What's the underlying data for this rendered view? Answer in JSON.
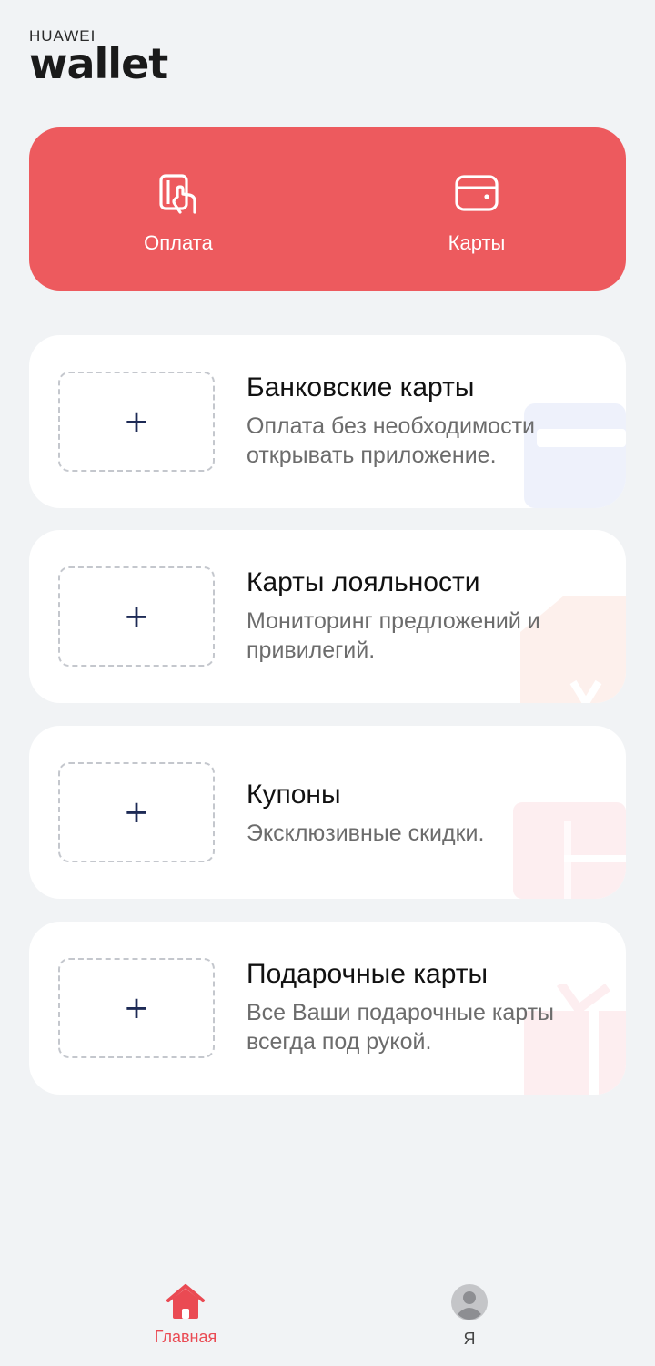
{
  "header": {
    "brand": "HUAWEI",
    "app_name": "wallet"
  },
  "quick_actions": [
    {
      "label": "Оплата",
      "icon": "payment-icon"
    },
    {
      "label": "Карты",
      "icon": "wallet-card-icon"
    }
  ],
  "categories": [
    {
      "title": "Банковские карты",
      "description": "Оплата без необходимости открывать приложение.",
      "icon": "bank-card-icon"
    },
    {
      "title": "Карты лояльности",
      "description": "Мониторинг предложений и привилегий.",
      "icon": "loyalty-card-icon"
    },
    {
      "title": "Купоны",
      "description": "Эксклюзивные скидки.",
      "icon": "coupon-icon"
    },
    {
      "title": "Подарочные карты",
      "description": "Все Ваши подарочные карты всегда под рукой.",
      "icon": "gift-card-icon"
    }
  ],
  "add_symbol": "+",
  "bottom_nav": [
    {
      "label": "Главная",
      "icon": "home-icon",
      "active": true
    },
    {
      "label": "Я",
      "icon": "avatar-icon",
      "active": false
    }
  ],
  "colors": {
    "accent": "#ed5a5e",
    "nav_active": "#ea4a53",
    "background": "#f1f3f5"
  }
}
